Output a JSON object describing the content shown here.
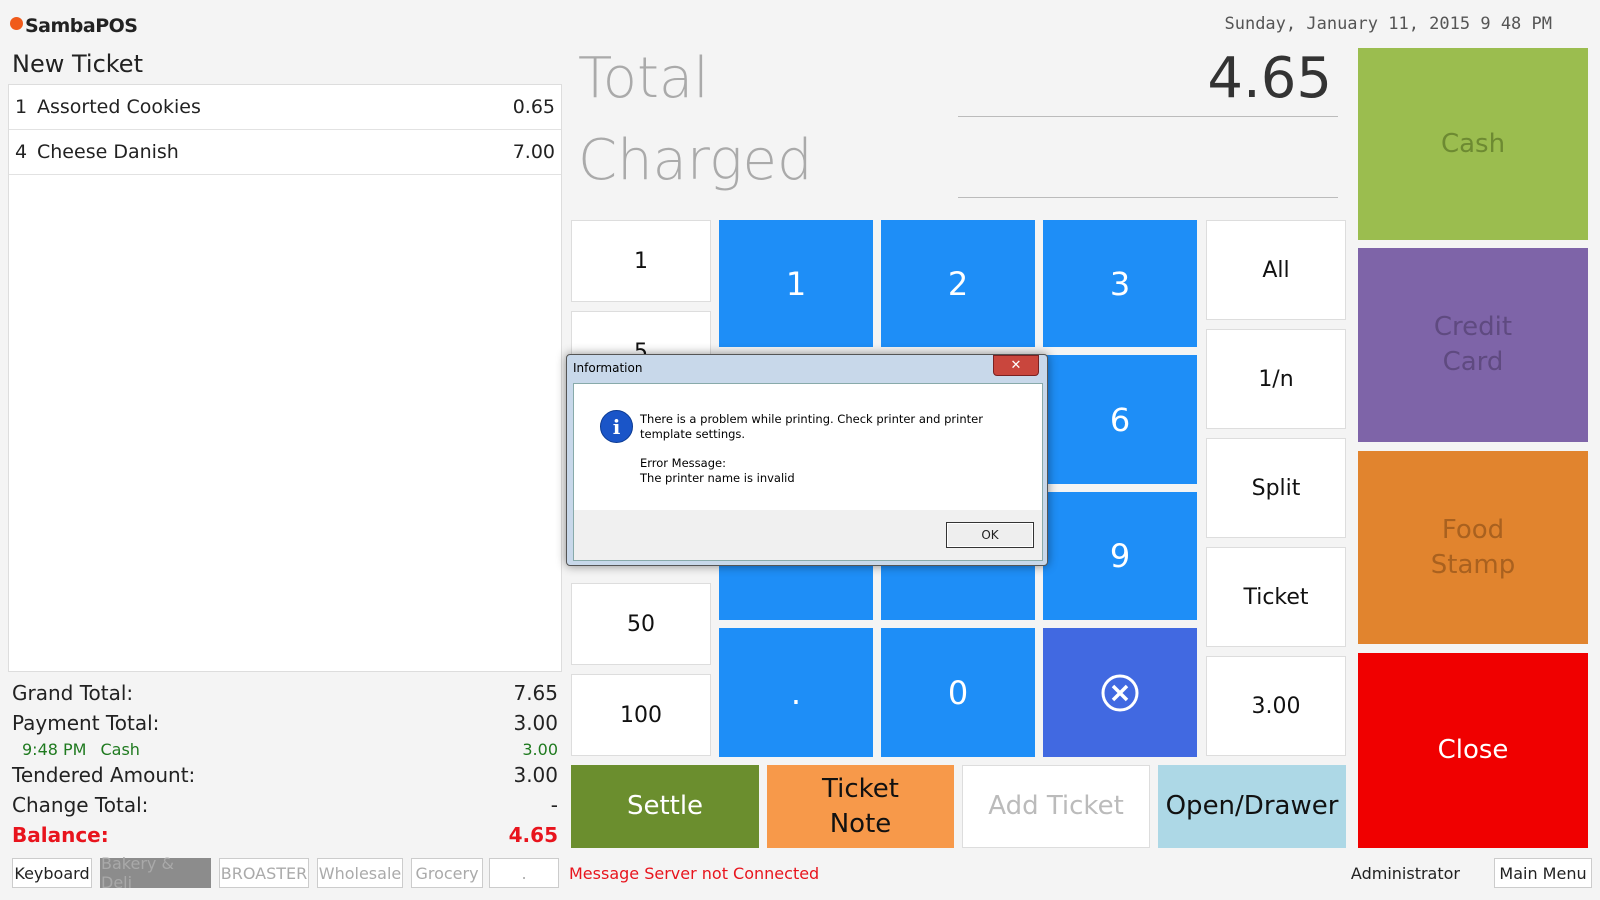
{
  "header": {
    "logo": "SambaPOS",
    "datetime": "Sunday, January 11, 2015 9 48 PM"
  },
  "ticket": {
    "title": "New Ticket",
    "orders": [
      {
        "qty": "1",
        "name": "Assorted Cookies",
        "price": "0.65"
      },
      {
        "qty": "4",
        "name": "Cheese Danish",
        "price": "7.00"
      }
    ]
  },
  "totals": {
    "grand_label": "Grand Total:",
    "grand_value": "7.65",
    "payment_label": "Payment Total:",
    "payment_value": "3.00",
    "payment_time": "9:48 PM",
    "payment_method": "Cash",
    "payment_line_value": "3.00",
    "tendered_label": "Tendered Amount:",
    "tendered_value": "3.00",
    "change_label": "Change Total:",
    "change_value": "-",
    "balance_label": "Balance:",
    "balance_value": "4.65"
  },
  "summary": {
    "total_label": "Total",
    "total_value": "4.65",
    "charged_label": "Charged"
  },
  "quick_amounts": [
    "1",
    "5",
    "50",
    "100"
  ],
  "numpad": [
    "1",
    "2",
    "3",
    "6",
    "9",
    ".",
    "0"
  ],
  "split_buttons": [
    "All",
    "1/n",
    "Split",
    "Ticket",
    "3.00"
  ],
  "actions": {
    "settle": "Settle",
    "ticket_note_1": "Ticket",
    "ticket_note_2": "Note",
    "add_ticket": "Add Ticket",
    "open_drawer": "Open/Drawer"
  },
  "payments": {
    "cash": "Cash",
    "credit_1": "Credit",
    "credit_2": "Card",
    "food_1": "Food",
    "food_2": "Stamp",
    "close": "Close"
  },
  "categories": [
    "Keyboard",
    "Bakery & Deli",
    "BROASTER",
    "Wholesale",
    "Grocery",
    "."
  ],
  "status": {
    "message": "Message Server not Connected",
    "user": "Administrator",
    "main_menu": "Main Menu"
  },
  "dialog": {
    "title": "Information",
    "line1": "There is a problem while printing. Check printer and printer template settings.",
    "line2": "Error Message:",
    "line3": "The printer name is invalid",
    "ok": "OK"
  },
  "colors": {
    "blue": "#1e8ef7",
    "settle": "#6b8e2e",
    "note": "#f7994a",
    "drawer": "#add8e6",
    "cash": "#9bbd4f",
    "credit": "#7e64a8",
    "food": "#e1842e",
    "close": "#f00000"
  }
}
